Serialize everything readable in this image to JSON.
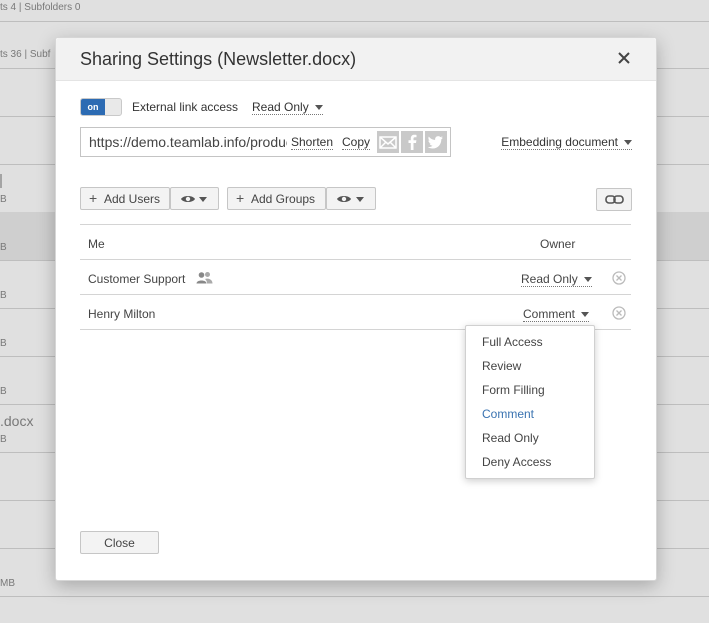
{
  "background": {
    "row1_text": "ts 4 | Subfolders 0",
    "row2_text": "ts 36 | Subf",
    "size_label_b": "B",
    "size_label_mb": "MB",
    "file_fragment": ".docx"
  },
  "dialog": {
    "title": "Sharing Settings (Newsletter.docx)",
    "toggle_label": "on",
    "external_label": "External link access",
    "external_access": "Read Only",
    "link_url": "https://demo.teamlab.info/products/files/doceditor.aspx",
    "shorten_label": "Shorten",
    "copy_label": "Copy",
    "embed_label": "Embedding document",
    "add_users_label": "Add Users",
    "add_groups_label": "Add Groups",
    "rows": [
      {
        "name": "Me",
        "right": "Owner"
      },
      {
        "name": "Customer Support",
        "access": "Read Only"
      },
      {
        "name": "Henry Milton",
        "access": "Comment"
      }
    ],
    "menu": [
      "Full Access",
      "Review",
      "Form Filling",
      "Comment",
      "Read Only",
      "Deny Access"
    ],
    "close_label": "Close"
  },
  "colors": {
    "accent": "#2c6bb3",
    "selected_item": "#3a73b1"
  }
}
